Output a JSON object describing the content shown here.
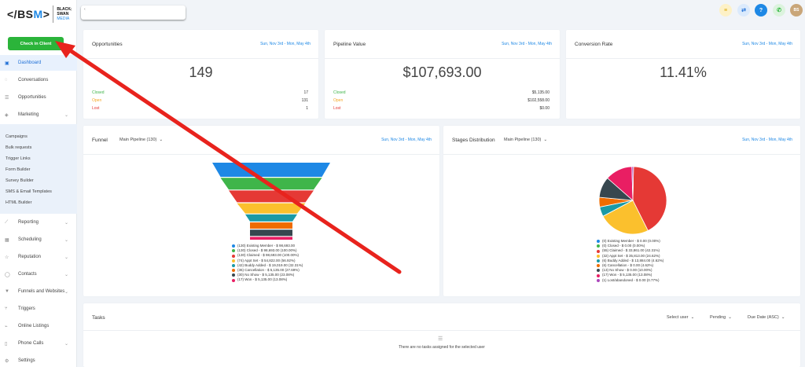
{
  "logo": {
    "mark_left": "</BS",
    "mark_m": "M",
    "mark_right": ">",
    "line1": "BLACK",
    "line2": "SWAN",
    "line3": "MEDIA"
  },
  "collapse_glyph": "‹",
  "search": {
    "placeholder": "‹"
  },
  "checkin_label": "Check in Client",
  "nav": [
    {
      "label": "Dashboard",
      "icon": "dashboard-icon",
      "glyph": "▣",
      "active": true
    },
    {
      "label": "Conversations",
      "icon": "chat-icon",
      "glyph": "◌"
    },
    {
      "label": "Opportunities",
      "icon": "list-icon",
      "glyph": "☰"
    },
    {
      "label": "Marketing",
      "icon": "megaphone-icon",
      "glyph": "◈",
      "chevron": "⌄"
    }
  ],
  "subnav": [
    "Campaigns",
    "Bulk requests",
    "Trigger Links",
    "Form Builder",
    "Survey Builder",
    "SMS & Email Templates",
    "HTML Builder"
  ],
  "nav2": [
    {
      "label": "Reporting",
      "icon": "chart-icon",
      "glyph": "⟋",
      "chevron": "⌄"
    },
    {
      "label": "Scheduling",
      "icon": "calendar-icon",
      "glyph": "▦",
      "chevron": "⌄"
    },
    {
      "label": "Reputation",
      "icon": "star-icon",
      "glyph": "☆",
      "chevron": "⌄"
    },
    {
      "label": "Contacts",
      "icon": "person-icon",
      "glyph": "◯",
      "chevron": "⌄"
    },
    {
      "label": "Funnels and Websites",
      "icon": "filter-icon",
      "glyph": "▼",
      "chevron": "⌄"
    },
    {
      "label": "Triggers",
      "icon": "branch-icon",
      "glyph": "⑂"
    },
    {
      "label": "Online Listings",
      "icon": "signal-icon",
      "glyph": "⌁"
    },
    {
      "label": "Phone Calls",
      "icon": "phone-icon",
      "glyph": "▯",
      "chevron": "⌄"
    },
    {
      "label": "Settings",
      "icon": "gear-icon",
      "glyph": "⚙"
    }
  ],
  "topbar": {
    "buttons": [
      {
        "name": "list-icon",
        "glyph": "≡",
        "bg": "#fdf1c7",
        "fg": "#d9a400"
      },
      {
        "name": "swap-icon",
        "glyph": "⇄",
        "bg": "#dbeafc",
        "fg": "#1e6fd6"
      },
      {
        "name": "help-icon",
        "glyph": "?",
        "bg": "#1e88e5",
        "fg": "#ffffff"
      },
      {
        "name": "phone-icon",
        "glyph": "✆",
        "bg": "#dcf3de",
        "fg": "#2bb43a"
      },
      {
        "name": "avatar",
        "glyph": "BS",
        "bg": "#c9a679",
        "fg": "#ffffff"
      }
    ]
  },
  "opportunities": {
    "title": "Opportunities",
    "date": "Sun, Nov 3rd - Mon, May 4th",
    "value": "149",
    "stats": [
      {
        "label": "Closed",
        "value": "17",
        "color": "#3fb54a"
      },
      {
        "label": "Open",
        "value": "131",
        "color": "#f5a623"
      },
      {
        "label": "Lost",
        "value": "1",
        "color": "#e53935"
      }
    ]
  },
  "pipeline_value": {
    "title": "Pipeline Value",
    "date": "Sun, Nov 3rd - Mon, May 4th",
    "value": "$107,693.00",
    "stats": [
      {
        "label": "Closed",
        "value": "$5,135.00",
        "color": "#3fb54a"
      },
      {
        "label": "Open",
        "value": "$102,558.00",
        "color": "#f5a623"
      },
      {
        "label": "Lost",
        "value": "$0.00",
        "color": "#e53935"
      }
    ]
  },
  "conversion": {
    "title": "Conversion Rate",
    "date": "Sun, Nov 3rd - Mon, May 4th",
    "value": "11.41%"
  },
  "funnel": {
    "title": "Funnel",
    "pipeline": "Main Pipeline (130)",
    "chevron": "⌄",
    "date": "Sun, Nov 3rd - Mon, May 4th",
    "legend": [
      {
        "label": "(130) Existing Member - $ 98,693.00",
        "color": "#1e88e5"
      },
      {
        "label": "(130) Closed - $ 98,693.00 (100.00%)",
        "color": "#3fb54a"
      },
      {
        "label": "(130) Claimed - $ 98,693.00 (100.00%)",
        "color": "#e53935"
      },
      {
        "label": "(74) Appt Set - $ 54,822.00 (56.92%)",
        "color": "#fbc02d"
      },
      {
        "label": "(42) Buddy Added - $ 19,019.00 (32.31%)",
        "color": "#1a9aa6"
      },
      {
        "label": "(36) Cancellation - $ 5,135.00 (27.69%)",
        "color": "#ef6c00"
      },
      {
        "label": "(30) No Show - $ 5,135.00 (23.08%)",
        "color": "#37474f"
      },
      {
        "label": "(17) Won - $ 5,135.00 (13.08%)",
        "color": "#e91e63"
      }
    ]
  },
  "stages": {
    "title": "Stages Distribution",
    "pipeline": "Main Pipeline (130)",
    "chevron": "⌄",
    "date": "Sun, Nov 3rd - Mon, May 4th",
    "legend": [
      {
        "label": "(0) Existing Member - $ 0.00 (0.00%)",
        "color": "#1e88e5"
      },
      {
        "label": "(0) Closed - $ 0.00 (0.00%)",
        "color": "#3fb54a"
      },
      {
        "label": "(55) Claimed - $ 33,861.00 (42.31%)",
        "color": "#e53935"
      },
      {
        "label": "(32) Appt Set - $ 35,813.00 (24.62%)",
        "color": "#fbc02d"
      },
      {
        "label": "(6) Buddy Added - $ 13,884.00 (4.62%)",
        "color": "#1a9aa6"
      },
      {
        "label": "(6) Cancellation - $ 0.00 (4.62%)",
        "color": "#ef6c00"
      },
      {
        "label": "(13) No Show - $ 0.00 (10.00%)",
        "color": "#37474f"
      },
      {
        "label": "(17) Won - $ 5,135.00 (13.08%)",
        "color": "#e91e63"
      },
      {
        "label": "(1) Lost/abandoned - $ 0.00 (0.77%)",
        "color": "#ab47bc"
      }
    ]
  },
  "tasks": {
    "title": "Tasks",
    "filters": [
      {
        "label": "Select user",
        "chevron": "⌄"
      },
      {
        "label": "Pending",
        "chevron": "⌄"
      },
      {
        "label": "Due Date (ASC)",
        "chevron": "⌄"
      }
    ],
    "empty_icon": "☰",
    "empty": "There are no tasks assigned for the selected user"
  },
  "pie_values": [
    0,
    0,
    42.31,
    24.62,
    4.62,
    4.62,
    10.0,
    13.08,
    0.77
  ],
  "funnel_values": [
    100,
    100,
    100,
    56.92,
    32.31,
    27.69,
    23.08,
    13.08
  ]
}
